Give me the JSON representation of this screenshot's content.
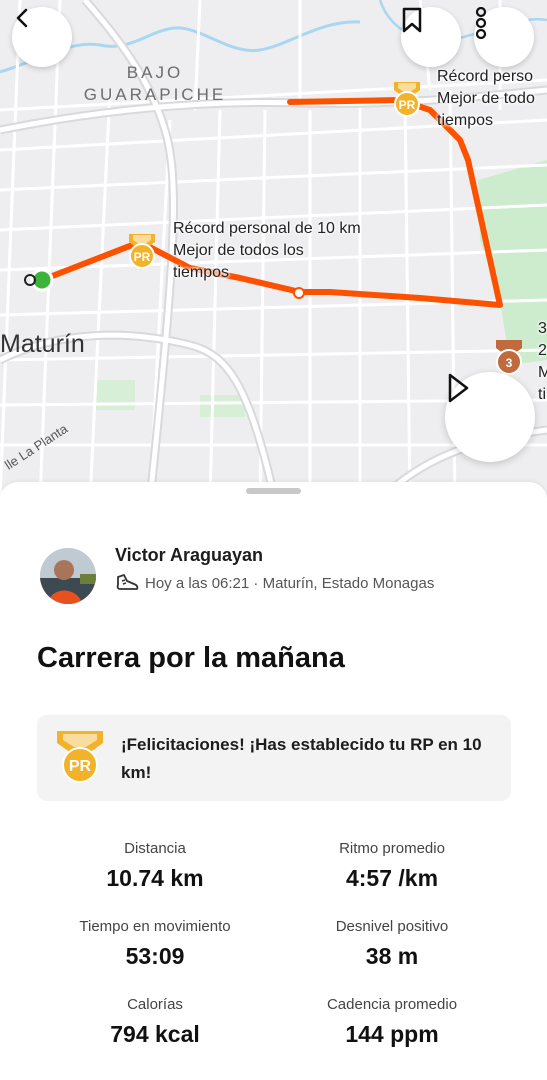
{
  "map": {
    "district_line1": "BAJO",
    "district_line2": "GUARAPICHE",
    "city": "Maturín",
    "street": "lle La Planta",
    "pins": [
      {
        "badge": "PR",
        "line1": "Récord personal de 10 km",
        "line2": "Mejor de todos los",
        "line3": "tiempos"
      },
      {
        "badge": "PR",
        "line1": "Récord perso",
        "line2": "Mejor de todo",
        "line3": "tiempos"
      },
      {
        "badge": "3",
        "line1": "3",
        "line2": "2",
        "line3": "M",
        "line4": "ti"
      }
    ],
    "route_color": "#fc5200"
  },
  "buttons": {
    "back_icon": "chevron-left-icon",
    "bookmark_icon": "bookmark-icon",
    "more_icon": "more-vertical-icon",
    "play_icon": "play-icon"
  },
  "athlete": {
    "name": "Victor Araguayan",
    "time": "Hoy a las 06:21",
    "separator": " · ",
    "location": "Maturín, Estado Monagas"
  },
  "activity": {
    "title": "Carrera por la mañana"
  },
  "pr_banner": {
    "badge": "PR",
    "message": "¡Felicitaciones! ¡Has establecido tu RP en 10 km!"
  },
  "stats": [
    {
      "label": "Distancia",
      "value": "10.74 km"
    },
    {
      "label": "Ritmo promedio",
      "value": "4:57 /km"
    },
    {
      "label": "Tiempo en movimiento",
      "value": "53:09"
    },
    {
      "label": "Desnivel positivo",
      "value": "38 m"
    },
    {
      "label": "Calorías",
      "value": "794 kcal"
    },
    {
      "label": "Cadencia promedio",
      "value": "144 ppm"
    }
  ],
  "colors": {
    "accent": "#fc5200",
    "pr_gold": "#f2b32a",
    "bronze": "#c06a3e",
    "start_green": "#3cb43c"
  }
}
